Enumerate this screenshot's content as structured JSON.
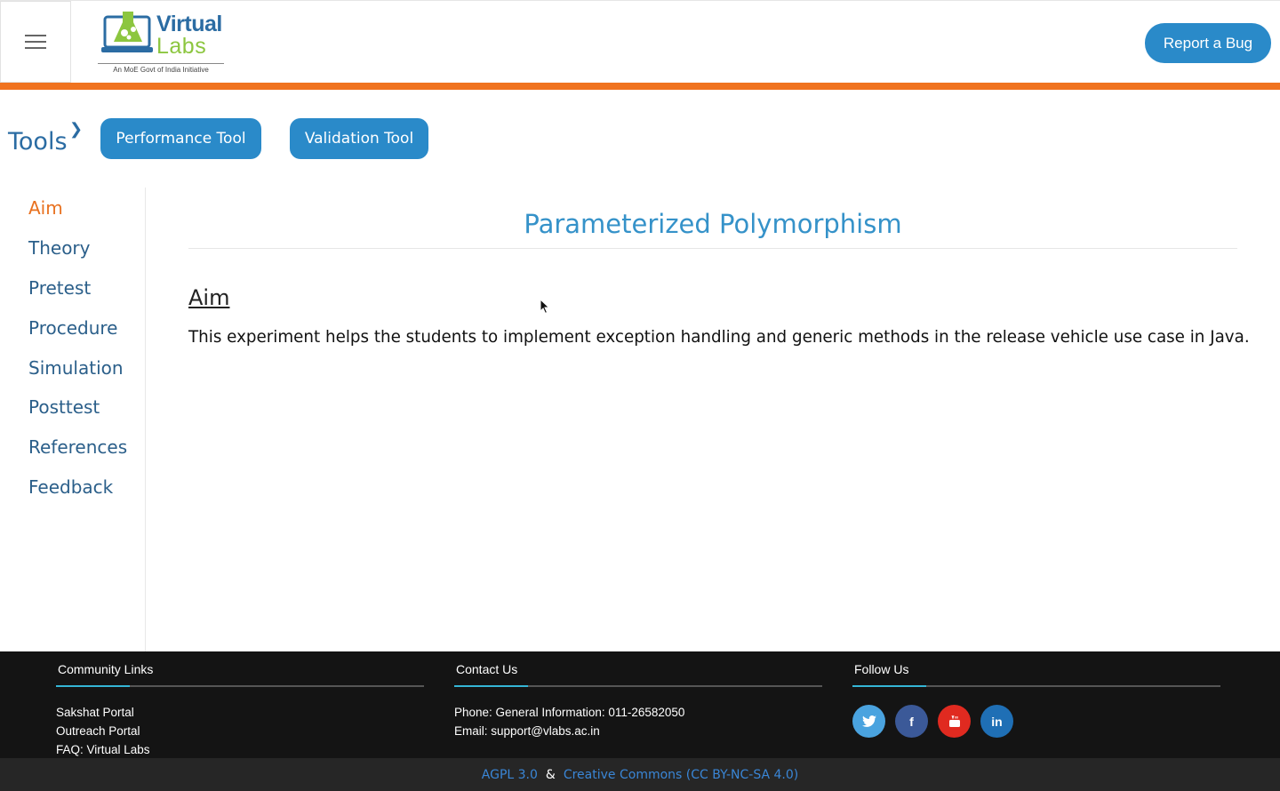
{
  "header": {
    "logo": {
      "word1": "Virtual",
      "word2": "Labs",
      "tagline": "An MoE Govt of India Initiative"
    },
    "report_bug_label": "Report a Bug",
    "accent_color": "#f0731f"
  },
  "tools": {
    "label": "Tools",
    "buttons": [
      "Performance Tool",
      "Validation Tool"
    ]
  },
  "sidebar": {
    "items": [
      {
        "label": "Aim",
        "active": true
      },
      {
        "label": "Theory",
        "active": false
      },
      {
        "label": "Pretest",
        "active": false
      },
      {
        "label": "Procedure",
        "active": false
      },
      {
        "label": "Simulation",
        "active": false
      },
      {
        "label": "Posttest",
        "active": false
      },
      {
        "label": "References",
        "active": false
      },
      {
        "label": "Feedback",
        "active": false
      }
    ]
  },
  "main": {
    "title": "Parameterized Polymorphism",
    "section_heading": "Aim",
    "section_body": "This experiment helps the students to implement exception handling and generic methods in the release vehicle use case in Java."
  },
  "footer": {
    "community": {
      "title": "Community Links",
      "links": [
        "Sakshat Portal",
        "Outreach Portal",
        "FAQ: Virtual Labs"
      ]
    },
    "contact": {
      "title": "Contact Us",
      "phone": "Phone: General Information: 011-26582050",
      "email": "Email: support@vlabs.ac.in"
    },
    "follow": {
      "title": "Follow Us",
      "icons": [
        {
          "name": "twitter-icon",
          "glyph": "🐦",
          "color": "#4aa3df"
        },
        {
          "name": "facebook-icon",
          "glyph": "f",
          "color": "#3b5998"
        },
        {
          "name": "youtube-icon",
          "glyph": "▶",
          "color": "#e02a20"
        },
        {
          "name": "linkedin-icon",
          "glyph": "in",
          "color": "#1f6fb5"
        }
      ]
    },
    "license": {
      "agpl": "AGPL 3.0",
      "amp": "&",
      "cc": "Creative Commons (CC BY-NC-SA 4.0)"
    }
  }
}
